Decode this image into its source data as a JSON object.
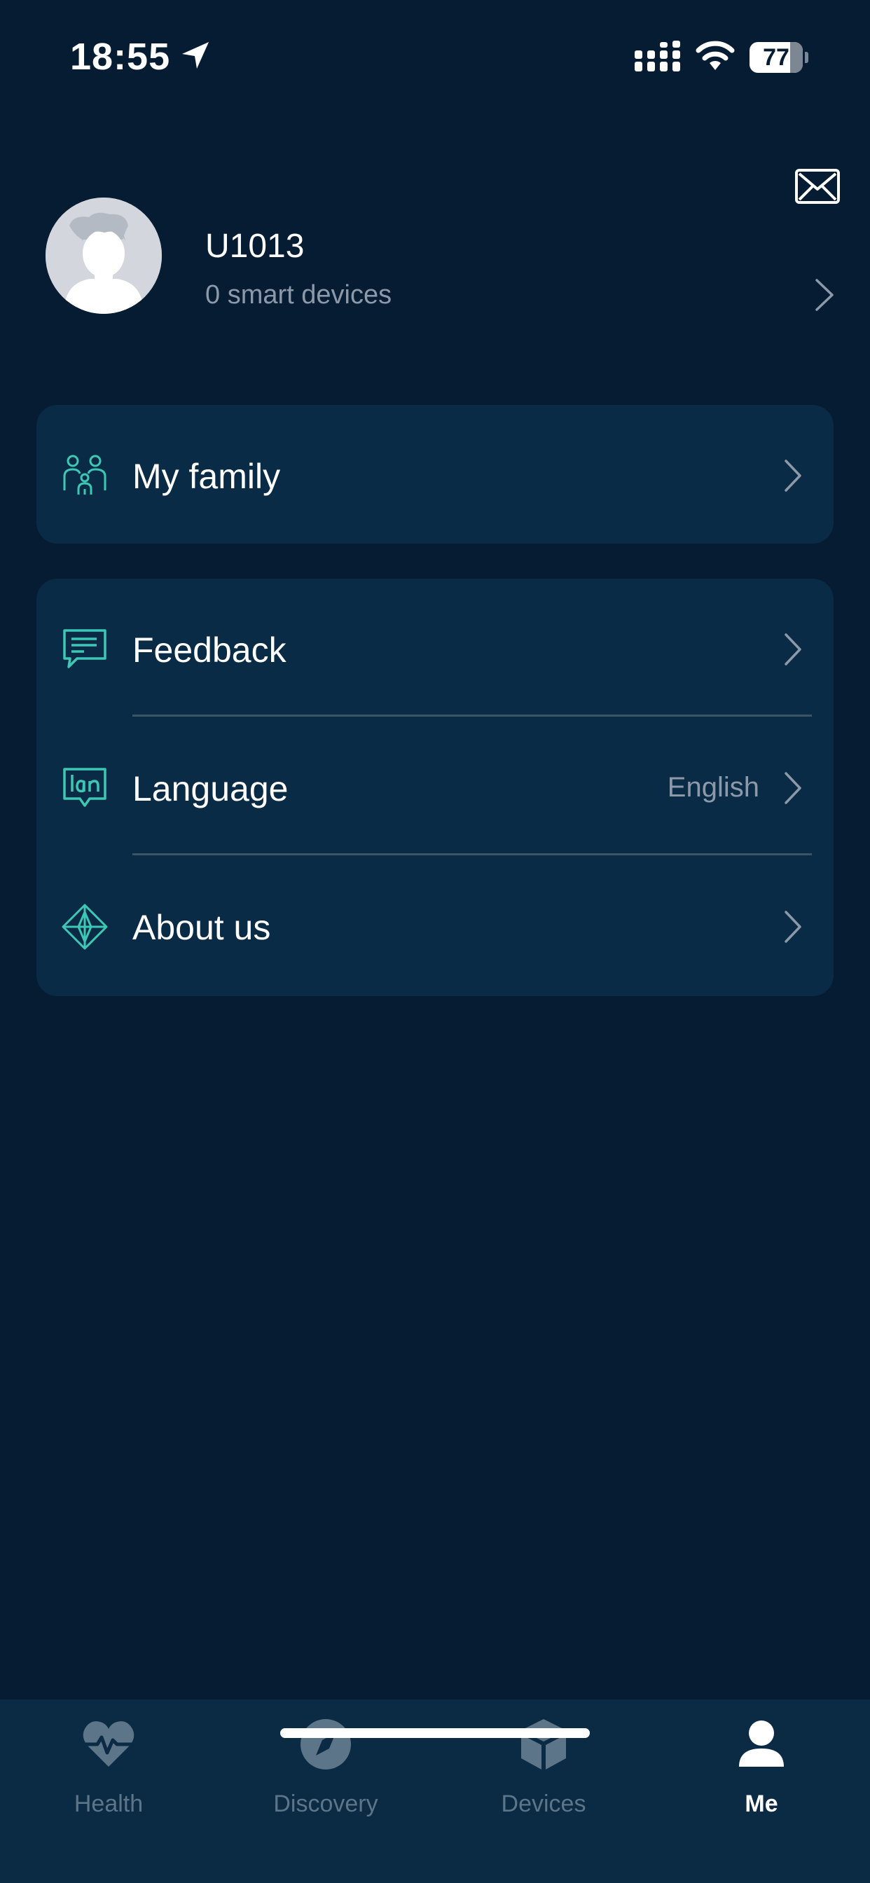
{
  "status_bar": {
    "time": "18:55",
    "battery_level": "77",
    "icons": [
      "location-arrow-icon",
      "cellular-signal-icon",
      "wifi-icon",
      "battery-icon"
    ]
  },
  "header": {
    "mail_icon": "envelope-icon"
  },
  "profile": {
    "name": "U1013",
    "subtitle": "0 smart devices"
  },
  "menu": {
    "family": {
      "label": "My family",
      "icon": "family-icon"
    },
    "feedback": {
      "label": "Feedback",
      "icon": "chat-bubble-icon"
    },
    "language": {
      "label": "Language",
      "value": "English",
      "icon": "language-icon"
    },
    "about": {
      "label": "About us",
      "icon": "diamond-compass-icon"
    }
  },
  "tabs": [
    {
      "label": "Health",
      "icon": "heart-pulse-icon",
      "active": false
    },
    {
      "label": "Discovery",
      "icon": "compass-icon",
      "active": false
    },
    {
      "label": "Devices",
      "icon": "cube-icon",
      "active": false
    },
    {
      "label": "Me",
      "icon": "person-icon",
      "active": true
    }
  ],
  "colors": {
    "background": "#061c33",
    "card": "#0a2b46",
    "accent": "#3cc8b4",
    "secondary_text": "#8c99a8",
    "inactive_tab": "#5d7589"
  }
}
